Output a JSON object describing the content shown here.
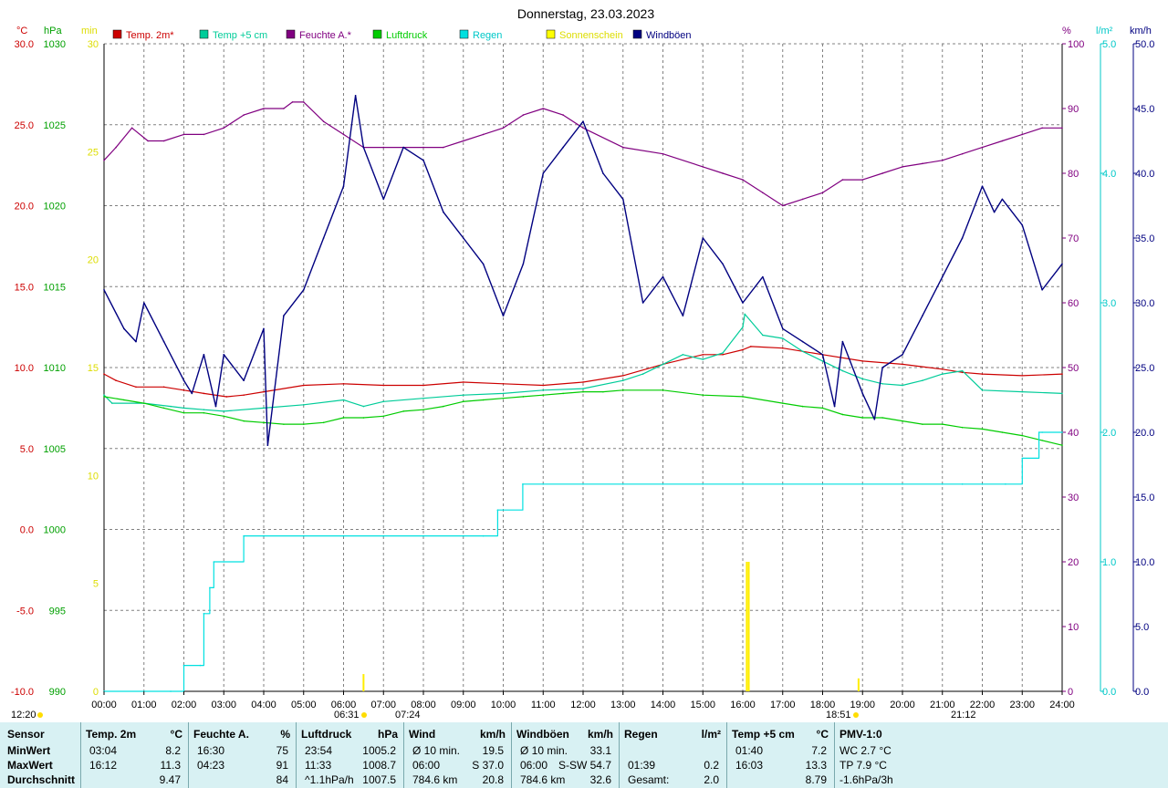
{
  "title": "Donnerstag, 23.03.2023",
  "units": {
    "temp": "°C",
    "pressure": "hPa",
    "sun": "min",
    "humidity": "%",
    "rain": "l/m²",
    "wind": "km/h"
  },
  "colors": {
    "temp2m": "#cc0000",
    "temp5cm": "#00cc99",
    "humidity": "#800080",
    "pressure": "#00cc00",
    "rain": "#00e0e0",
    "sun": "#ffff00",
    "wind": "#000080",
    "axisTemp": "#cc0000",
    "axisPressure": "#00a000",
    "axisSun": "#dddd00",
    "axisHumidity": "#800080",
    "axisRain": "#00c8c8",
    "axisWind": "#000080"
  },
  "legend": [
    {
      "label": "Temp. 2m*",
      "color": "#cc0000"
    },
    {
      "label": "Temp +5 cm",
      "color": "#00cc99"
    },
    {
      "label": "Feuchte A.*",
      "color": "#800080"
    },
    {
      "label": "Luftdruck",
      "color": "#00cc00"
    },
    {
      "label": "Regen",
      "color": "#00e0e0"
    },
    {
      "label": "Sonnenschein",
      "color": "#ffff00"
    },
    {
      "label": "Windböen",
      "color": "#000080"
    }
  ],
  "chart_data": {
    "type": "line",
    "title": "Donnerstag, 23.03.2023",
    "x_ticks": [
      "00:00",
      "01:00",
      "02:00",
      "03:00",
      "04:00",
      "05:00",
      "06:00",
      "07:00",
      "08:00",
      "09:00",
      "10:00",
      "11:00",
      "12:00",
      "13:00",
      "14:00",
      "15:00",
      "16:00",
      "17:00",
      "18:00",
      "19:00",
      "20:00",
      "21:00",
      "22:00",
      "23:00",
      "24:00"
    ],
    "axes": {
      "temp": {
        "ylim": [
          -10,
          30
        ],
        "ticks": [
          "30.0",
          "25.0",
          "20.0",
          "15.0",
          "10.0",
          "5.0",
          "0.0",
          "-5.0",
          "-10.0"
        ]
      },
      "pressure": {
        "ylim": [
          990,
          1030
        ],
        "ticks": [
          "1030",
          "1025",
          "1020",
          "1015",
          "1010",
          "1005",
          "1000",
          "995",
          "990"
        ]
      },
      "sun": {
        "ylim": [
          0,
          30
        ],
        "ticks": [
          "30",
          "25",
          "20",
          "15",
          "10",
          "5",
          "0"
        ]
      },
      "humidity": {
        "ylim": [
          0,
          100
        ],
        "ticks": [
          "100",
          "90",
          "80",
          "70",
          "60",
          "50",
          "40",
          "30",
          "20",
          "10",
          "0"
        ]
      },
      "rain": {
        "ylim": [
          0,
          5
        ],
        "ticks": [
          "5.0",
          "4.0",
          "3.0",
          "2.0",
          "1.0",
          "0.0"
        ]
      },
      "wind": {
        "ylim": [
          0,
          50
        ],
        "ticks": [
          "50.0",
          "45.0",
          "40.0",
          "35.0",
          "30.0",
          "25.0",
          "20.0",
          "15.0",
          "10.0",
          "5.0",
          "0.0"
        ]
      }
    },
    "series": [
      {
        "name": "Temp. 2m*",
        "key": "temp2m",
        "axis": "temp",
        "x": [
          0,
          0.3,
          0.8,
          1.5,
          2,
          2.5,
          3.07,
          3.5,
          4,
          5,
          6,
          7,
          8,
          9,
          10,
          11,
          12,
          13,
          14,
          15,
          15.5,
          16,
          16.2,
          17,
          18,
          19,
          20,
          21,
          21.5,
          22,
          23,
          24
        ],
        "y": [
          9.6,
          9.2,
          8.8,
          8.8,
          8.6,
          8.4,
          8.2,
          8.3,
          8.5,
          8.9,
          9.0,
          8.9,
          8.9,
          9.1,
          9.0,
          8.9,
          9.1,
          9.5,
          10.2,
          10.8,
          10.8,
          11.1,
          11.3,
          11.2,
          10.8,
          10.4,
          10.2,
          9.9,
          9.7,
          9.6,
          9.5,
          9.6
        ]
      },
      {
        "name": "Temp +5 cm",
        "key": "temp5cm",
        "axis": "temp",
        "x": [
          0,
          0.2,
          1,
          1.67,
          2,
          2.5,
          3,
          4,
          5,
          6,
          6.5,
          7,
          8,
          9,
          10,
          11,
          12,
          13,
          13.5,
          14,
          14.5,
          15,
          15.5,
          16,
          16.05,
          16.5,
          17,
          17.5,
          18,
          18.5,
          19,
          19.5,
          20,
          20.5,
          21,
          21.5,
          22,
          23,
          24
        ],
        "y": [
          8.3,
          7.8,
          7.8,
          7.6,
          7.5,
          7.4,
          7.3,
          7.5,
          7.7,
          8.0,
          7.6,
          7.9,
          8.1,
          8.3,
          8.4,
          8.6,
          8.7,
          9.2,
          9.6,
          10.2,
          10.8,
          10.5,
          10.9,
          12.5,
          13.3,
          12.0,
          11.8,
          11.0,
          10.4,
          9.8,
          9.3,
          9.0,
          8.9,
          9.2,
          9.6,
          9.8,
          8.6,
          8.5,
          8.4
        ]
      },
      {
        "name": "Feuchte A.*",
        "key": "humidity",
        "axis": "humidity",
        "x": [
          0,
          0.3,
          0.7,
          1.1,
          1.5,
          2,
          2.5,
          3,
          3.5,
          4,
          4.5,
          4.72,
          5,
          5.5,
          6,
          6.5,
          7,
          7.5,
          8,
          8.5,
          9,
          9.5,
          10,
          10.5,
          11,
          11.5,
          12,
          13,
          14,
          15,
          15.5,
          16,
          16.5,
          17,
          17.5,
          18,
          18.5,
          19,
          19.5,
          20,
          20.5,
          21,
          21.5,
          22,
          22.5,
          23,
          23.5,
          24
        ],
        "y": [
          82,
          84,
          87,
          85,
          85,
          86,
          86,
          87,
          89,
          90,
          90,
          91,
          91,
          88,
          86,
          84,
          84,
          84,
          84,
          84,
          85,
          86,
          87,
          89,
          90,
          89,
          87,
          84,
          83,
          81,
          80,
          79,
          77,
          75,
          76,
          77,
          79,
          79,
          80,
          81,
          81.5,
          82,
          83,
          84,
          85,
          86,
          87,
          87
        ]
      },
      {
        "name": "Luftdruck",
        "key": "pressure",
        "axis": "pressure",
        "x": [
          0,
          0.5,
          1,
          1.5,
          2,
          2.5,
          3,
          3.5,
          4,
          4.5,
          5,
          5.5,
          6,
          6.5,
          7,
          7.5,
          8,
          8.5,
          9,
          9.5,
          10,
          10.5,
          11,
          11.5,
          12,
          12.5,
          13,
          14,
          15,
          16,
          17,
          17.5,
          18,
          18.5,
          19,
          19.5,
          20,
          20.5,
          21,
          21.5,
          22,
          22.5,
          23,
          23.5,
          24
        ],
        "y": [
          1008.2,
          1008.0,
          1007.8,
          1007.5,
          1007.2,
          1007.2,
          1007.0,
          1006.7,
          1006.6,
          1006.5,
          1006.5,
          1006.6,
          1006.9,
          1006.9,
          1007.0,
          1007.3,
          1007.4,
          1007.6,
          1007.9,
          1008.0,
          1008.1,
          1008.2,
          1008.3,
          1008.4,
          1008.5,
          1008.5,
          1008.6,
          1008.6,
          1008.3,
          1008.2,
          1007.8,
          1007.6,
          1007.5,
          1007.1,
          1006.9,
          1006.9,
          1006.7,
          1006.5,
          1006.5,
          1006.3,
          1006.2,
          1006.0,
          1005.8,
          1005.5,
          1005.2
        ]
      },
      {
        "name": "Regen",
        "key": "rain",
        "axis": "rain",
        "x": [
          0,
          1.67,
          2,
          2.41,
          2.5,
          2.65,
          2.75,
          3.0,
          3.5,
          4,
          5,
          6,
          7,
          8,
          9,
          9.5,
          9.86,
          10.49,
          11,
          12,
          13,
          14,
          15,
          16,
          17,
          18,
          19,
          20,
          21,
          21.5,
          22,
          22.58,
          23,
          23.42,
          23.5,
          24
        ],
        "y": [
          0,
          0,
          0.2,
          0.2,
          0.6,
          0.8,
          1.0,
          1.0,
          1.2,
          1.2,
          1.2,
          1.2,
          1.2,
          1.2,
          1.2,
          1.2,
          1.4,
          1.6,
          1.6,
          1.6,
          1.6,
          1.6,
          1.6,
          1.6,
          1.6,
          1.6,
          1.6,
          1.6,
          1.6,
          1.6,
          1.6,
          1.6,
          1.8,
          2.0,
          2.0,
          2.0
        ]
      },
      {
        "name": "Sonnenschein",
        "key": "sun",
        "axis": "sun",
        "x": [
          6.5,
          16.1,
          16.15,
          18.9
        ],
        "y": [
          0.8,
          6.0,
          6.0,
          0.6
        ]
      },
      {
        "name": "Windböen",
        "key": "wind",
        "axis": "wind",
        "x": [
          0,
          0.5,
          0.8,
          1,
          1.5,
          2,
          2.2,
          2.5,
          2.8,
          3,
          3.5,
          4,
          4.1,
          4.5,
          5,
          5.5,
          6,
          6.3,
          6.5,
          7,
          7.5,
          8,
          8.5,
          9,
          9.5,
          10,
          10.5,
          11,
          11.5,
          12,
          12.5,
          13,
          13.5,
          14,
          14.5,
          15,
          15.5,
          16,
          16.5,
          17,
          17.5,
          18,
          18.3,
          18.5,
          19,
          19.3,
          19.5,
          20,
          20.5,
          21,
          21.5,
          22,
          22.3,
          22.5,
          23,
          23.5,
          24
        ],
        "y": [
          31,
          28,
          27,
          30,
          27,
          24,
          23,
          26,
          22,
          26,
          24,
          28,
          19,
          29,
          31,
          35,
          39,
          46,
          42,
          38,
          42,
          41,
          37,
          35,
          33,
          29,
          33,
          40,
          42,
          44,
          40,
          38,
          30,
          32,
          29,
          35,
          33,
          30,
          32,
          28,
          27,
          26,
          22,
          27,
          23,
          21,
          25,
          26,
          29,
          32,
          35,
          39,
          37,
          38,
          36,
          31,
          33
        ]
      }
    ]
  },
  "stats": {
    "sensor": {
      "head": "Sensor",
      "rows": [
        "MinWert",
        "MaxWert",
        "Durchschnitt"
      ]
    },
    "temp2m": {
      "head": "Temp. 2m",
      "unit": "°C",
      "rows": [
        {
          "time": "03:04",
          "val": "8.2"
        },
        {
          "time": "16:12",
          "val": "11.3"
        },
        {
          "time": "",
          "val": "9.47"
        }
      ]
    },
    "feuchte": {
      "head": "Feuchte A.",
      "unit": "%",
      "rows": [
        {
          "time": "16:30",
          "val": "75"
        },
        {
          "time": "04:23",
          "val": "91"
        },
        {
          "time": "",
          "val": "84"
        }
      ]
    },
    "luftdruck": {
      "head": "Luftdruck",
      "unit": "hPa",
      "rows": [
        {
          "time": "23:54",
          "val": "1005.2"
        },
        {
          "time": "11:33",
          "val": "1008.7"
        },
        {
          "time": "^1.1hPa/h",
          "val": "1007.5"
        }
      ]
    },
    "wind": {
      "head": "Wind",
      "unit": "km/h",
      "rows": [
        {
          "time": "Ø 10 min.",
          "val": "19.5"
        },
        {
          "time": "06:00",
          "val": "S 37.0"
        },
        {
          "time": "784.6 km",
          "val": "20.8"
        }
      ]
    },
    "windboen": {
      "head": "Windböen",
      "unit": "km/h",
      "rows": [
        {
          "time": "Ø 10 min.",
          "val": "33.1"
        },
        {
          "time": "06:00",
          "val": "S-SW 54.7"
        },
        {
          "time": "784.6 km",
          "val": "32.6"
        }
      ]
    },
    "regen": {
      "head": "Regen",
      "unit": "l/m²",
      "rows": [
        {
          "time": "",
          "val": ""
        },
        {
          "time": "01:39",
          "val": "0.2"
        },
        {
          "time": "Gesamt:",
          "val": "2.0"
        }
      ]
    },
    "temp5cm": {
      "head": "Temp +5 cm",
      "unit": "°C",
      "rows": [
        {
          "time": "01:40",
          "val": "7.2"
        },
        {
          "time": "16:03",
          "val": "13.3"
        },
        {
          "time": "",
          "val": "8.79"
        }
      ]
    },
    "pmv": {
      "head": "PMV-1:0",
      "rows": [
        "WC 2.7 °C",
        "TP 7.9 °C",
        "-1.6hPa/3h"
      ]
    }
  },
  "sun_events": {
    "sunrise": "06:31",
    "sunset": "18:51",
    "moonrise": "07:24",
    "moonset": "21:12",
    "bottom_left_time": "12:20"
  }
}
